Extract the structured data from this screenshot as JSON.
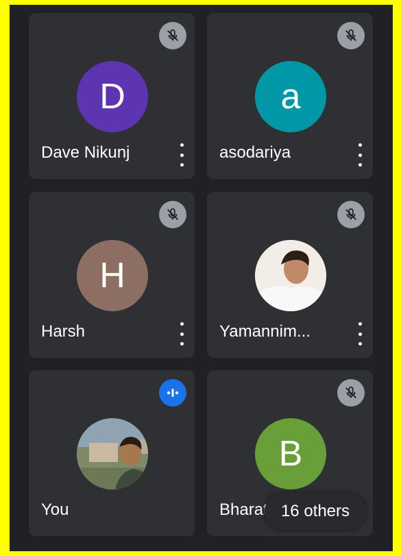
{
  "participants": [
    {
      "name": "Dave Nikunj",
      "initial": "D",
      "avatar_color": "#5e35b1",
      "muted": true
    },
    {
      "name": "asodariya",
      "initial": "a",
      "avatar_color": "#0097a7",
      "muted": true
    },
    {
      "name": "Harsh",
      "initial": "H",
      "avatar_color": "#8d6e63",
      "muted": true
    },
    {
      "name": "Yamannim...",
      "initial": "",
      "avatar_color": "#e8e0d8",
      "muted": true
    },
    {
      "name": "You",
      "initial": "",
      "avatar_color": "#6b7d62",
      "speaking": true
    },
    {
      "name": "Bharat",
      "initial": "B",
      "avatar_color": "#689f38",
      "muted": true
    }
  ],
  "others_label": "16 others",
  "colors": {
    "frame_border": "#ffff00",
    "background": "#202124",
    "tile": "#2f3033",
    "mute_bg": "#9aa0a6",
    "speaking_bg": "#1a73e8"
  }
}
